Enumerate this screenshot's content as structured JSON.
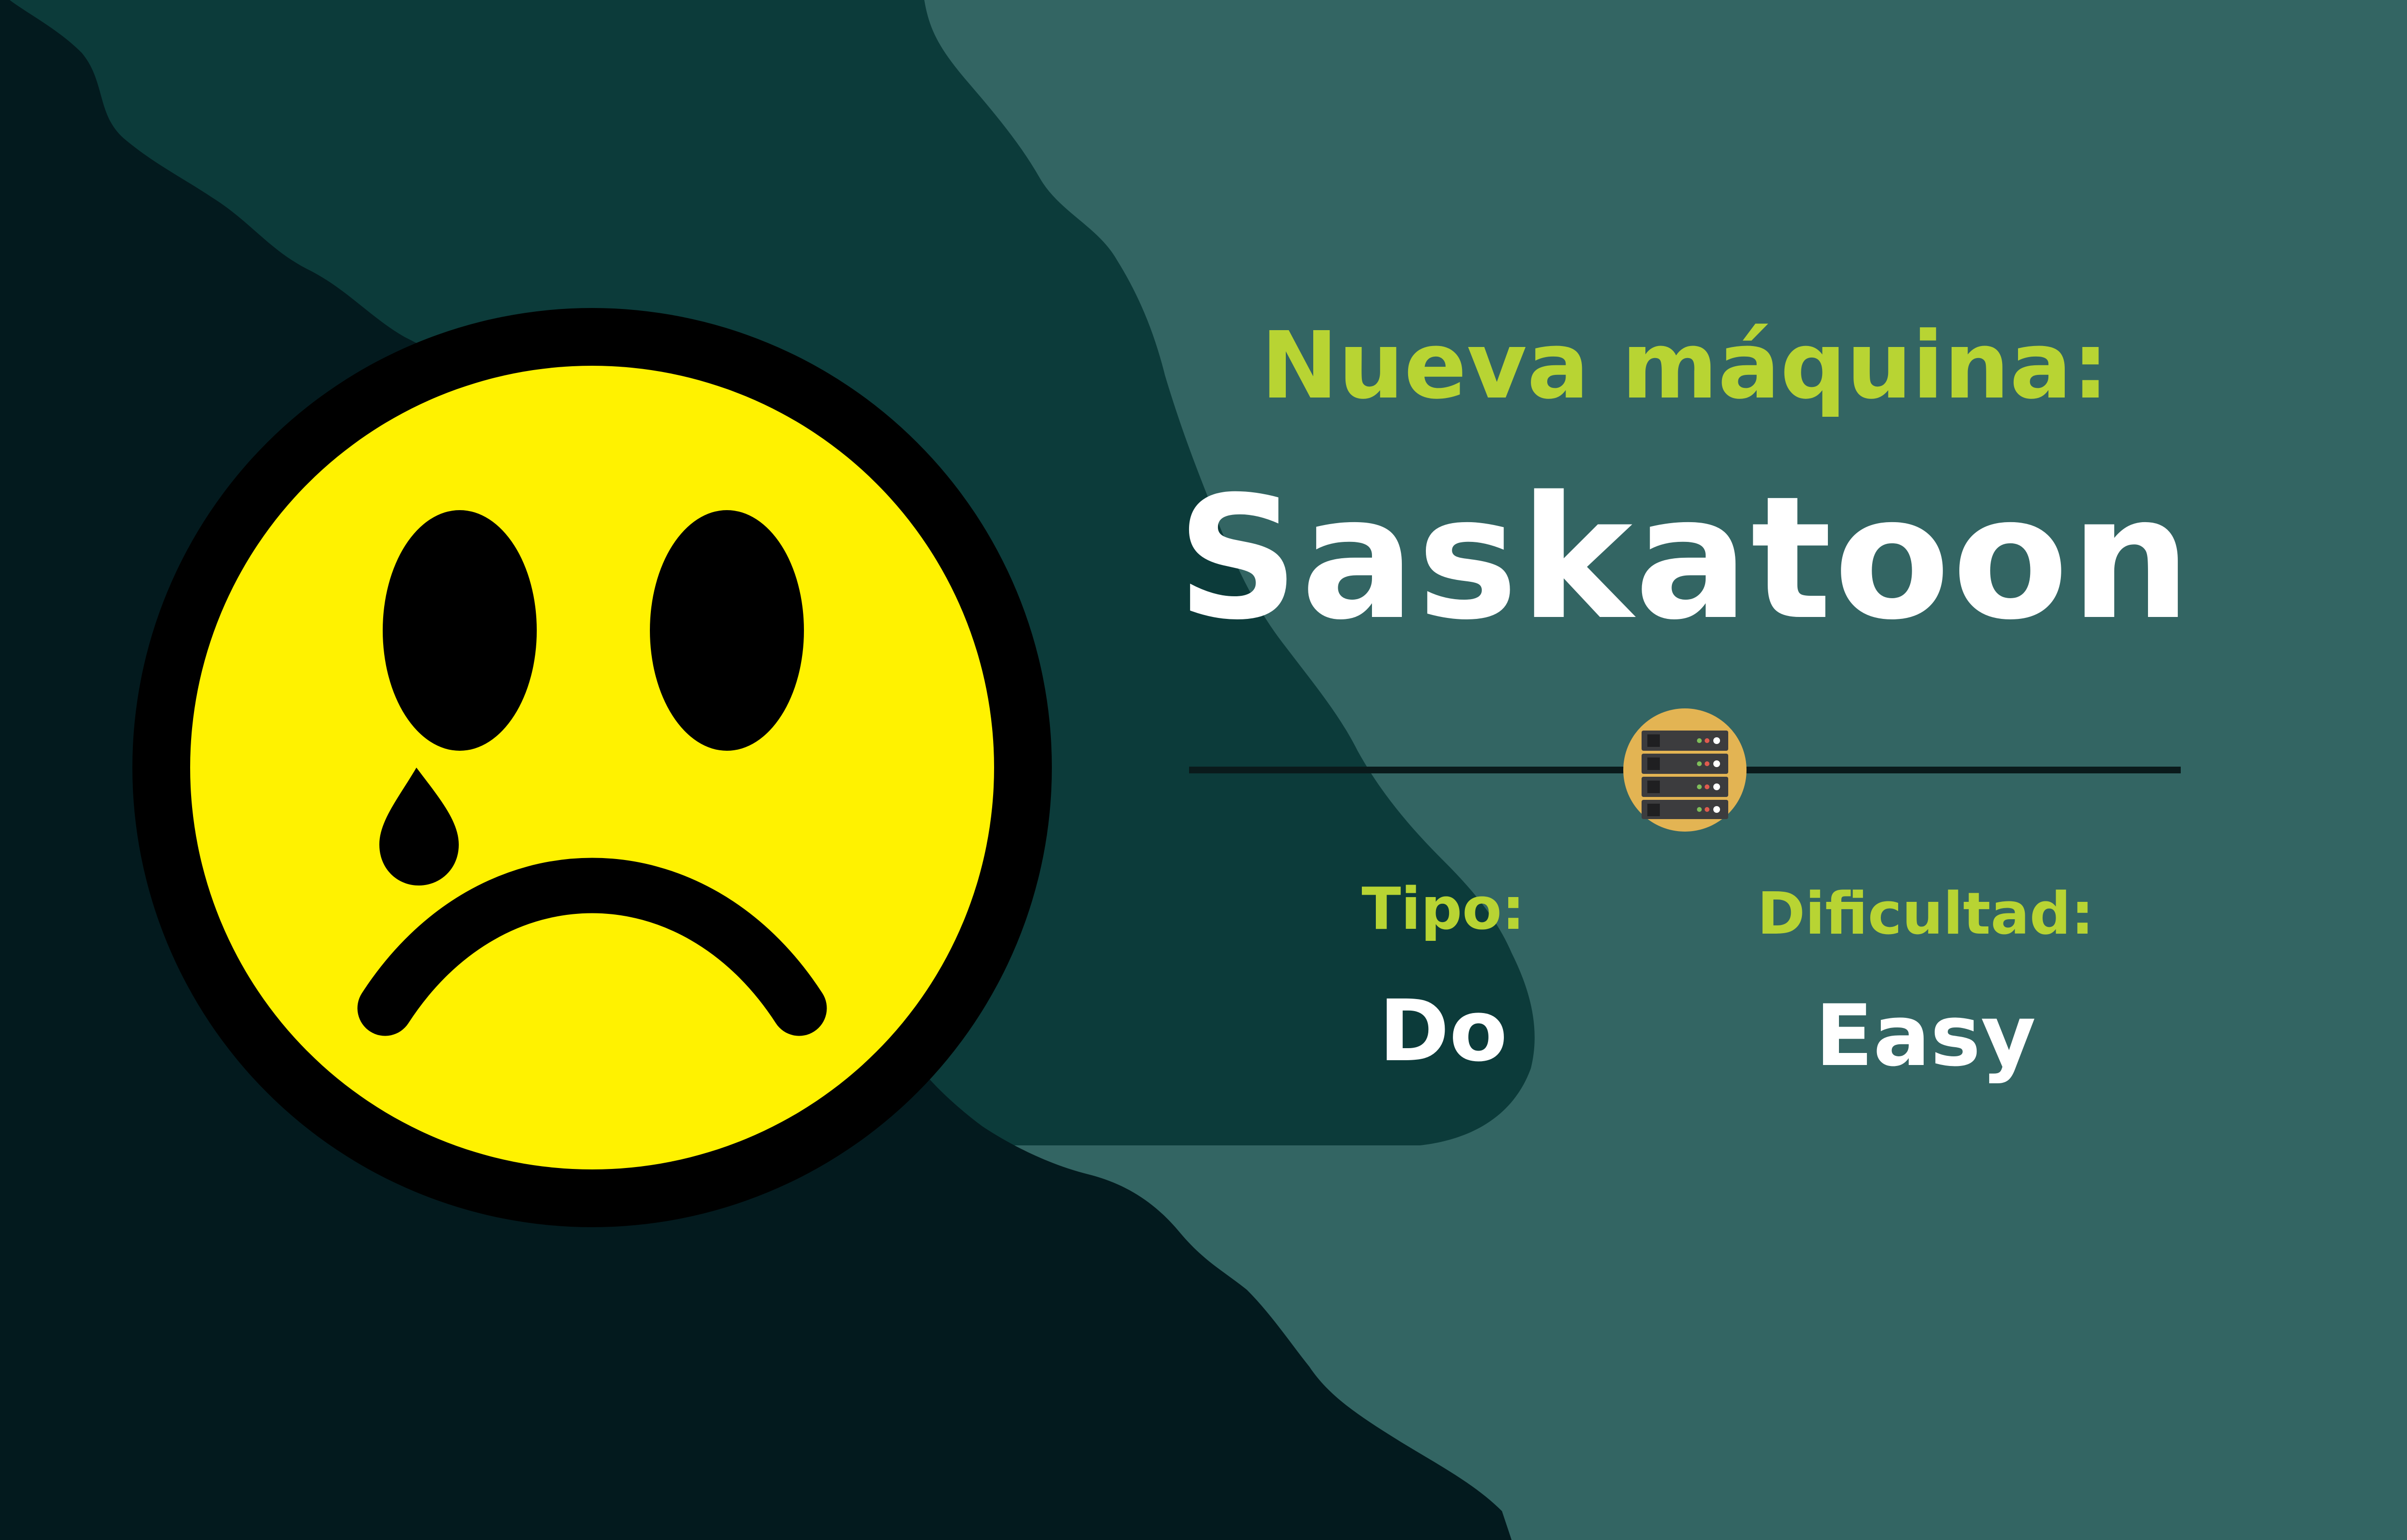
{
  "heading": {
    "label": "Nueva máquina:",
    "machine_name": "Saskatoon"
  },
  "details": {
    "tipo_label": "Tipo:",
    "tipo_value": "Do",
    "dificultad_label": "Dificultad:",
    "dificultad_value": "Easy"
  },
  "icons": {
    "face": "crying-sad-face-icon",
    "divider_badge": "server-rack-icon"
  },
  "colors": {
    "background_light": "#336563",
    "background_mid": "#0c3b3a",
    "background_dark": "#031a1e",
    "accent_text": "#b8d433",
    "primary_text": "#ffffff",
    "face_yellow": "#fff200",
    "face_outline": "#000000",
    "badge_fill": "#e3b453"
  }
}
